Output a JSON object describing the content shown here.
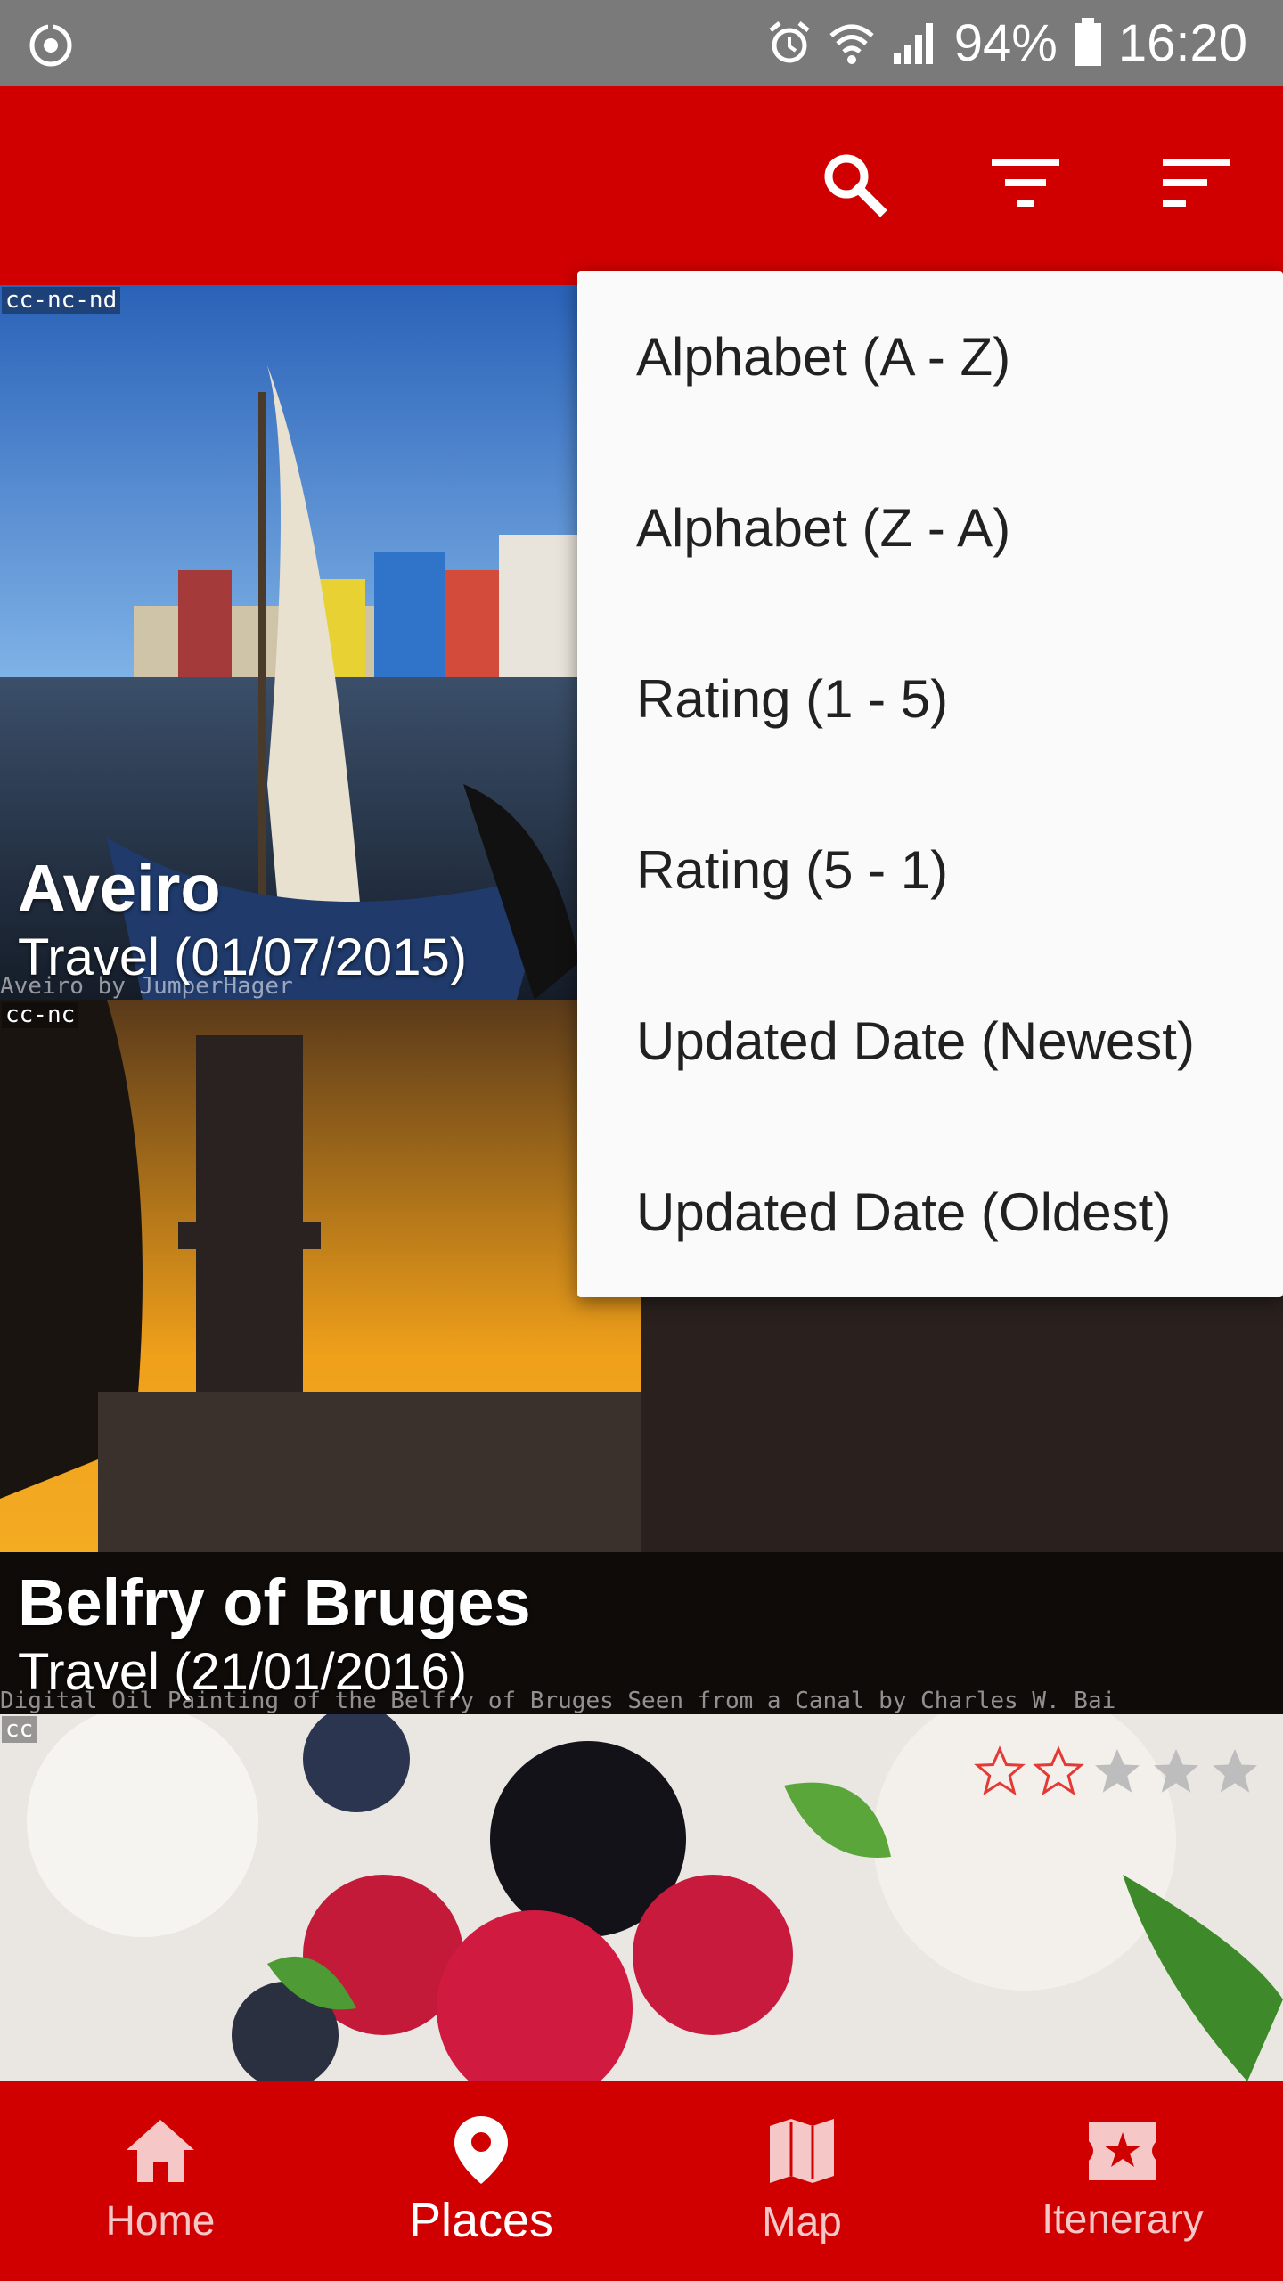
{
  "status_bar": {
    "battery": "94%",
    "time": "16:20"
  },
  "toolbar": {
    "icons": [
      "search-icon",
      "filter-icon",
      "sort-icon"
    ]
  },
  "cards": [
    {
      "title": "Aveiro",
      "subtitle": "Travel (01/07/2015)",
      "license": "cc-nc-nd",
      "credit": "Aveiro by JumperHager"
    },
    {
      "title": "Belfry of Bruges",
      "subtitle": "Travel (21/01/2016)",
      "license": "cc-nc",
      "credit": "Digital Oil Painting of the Belfry of Bruges Seen from a Canal by Charles W. Bai"
    },
    {
      "license": "cc",
      "rating": 2,
      "rating_max": 5
    }
  ],
  "sort_menu": {
    "items": [
      "Alphabet (A - Z)",
      "Alphabet (Z - A)",
      "Rating (1 - 5)",
      "Rating (5 - 1)",
      "Updated Date (Newest)",
      "Updated Date (Oldest)"
    ]
  },
  "bottom_nav": {
    "active": "Places",
    "items": [
      {
        "label": "Home",
        "icon": "home-icon"
      },
      {
        "label": "Places",
        "icon": "location-pin-icon"
      },
      {
        "label": "Map",
        "icon": "map-icon"
      },
      {
        "label": "Itenerary",
        "icon": "ticket-star-icon"
      }
    ]
  },
  "colors": {
    "primary": "#d10000",
    "status_bar": "#7a7a7a",
    "menu_bg": "#fafafa",
    "star_filled": "#e53935",
    "star_empty": "#bdbdbd"
  }
}
